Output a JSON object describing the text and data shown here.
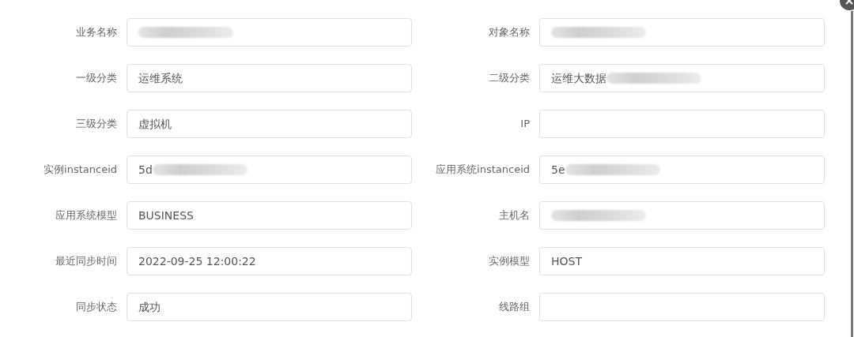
{
  "rows": [
    {
      "left": {
        "label": "业务名称",
        "redacted": true
      },
      "right": {
        "label": "对象名称",
        "redacted": true
      }
    },
    {
      "left": {
        "label": "一级分类",
        "value": "运维系统",
        "redacted": false
      },
      "right": {
        "label": "二级分类",
        "value": "运维大数据",
        "redacted": true
      }
    },
    {
      "left": {
        "label": "三级分类",
        "value": "虚拟机",
        "redacted": false
      },
      "right": {
        "label": "IP",
        "redacted": false
      }
    },
    {
      "left": {
        "label": "实例instanceid",
        "value": "5d",
        "redacted": true
      },
      "right": {
        "label": "应用系统instanceid",
        "value": "5e",
        "redacted": true
      }
    },
    {
      "left": {
        "label": "应用系统模型",
        "value": "BUSINESS",
        "redacted": false
      },
      "right": {
        "label": "主机名",
        "redacted": true
      }
    },
    {
      "left": {
        "label": "最近同步时间",
        "value": "2022-09-25 12:00:22",
        "redacted": false
      },
      "right": {
        "label": "实例模型",
        "value": "HOST",
        "redacted": false
      }
    },
    {
      "left": {
        "label": "同步状态",
        "value": "成功",
        "redacted": false
      },
      "right": {
        "label": "线路组",
        "redacted": false
      }
    }
  ]
}
